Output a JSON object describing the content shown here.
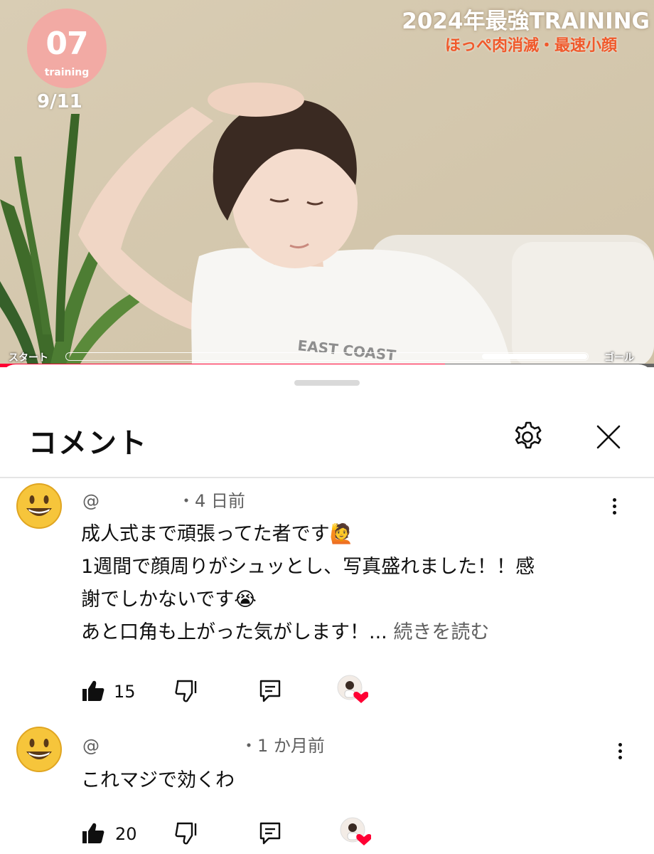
{
  "video": {
    "badge_number": "07",
    "badge_label": "training",
    "progress_count": "9/11",
    "title_line1": "2024年最強TRAINING",
    "title_line2": "ほっぺ肉消滅・最速小顔",
    "start_label": "スタート",
    "goal_label": "ゴール",
    "playback_progress_fraction": 0.68,
    "shirt_text": "EAST COAST",
    "accent_color": "#ff0033",
    "badge_color": "#f2aaa4"
  },
  "sheet": {
    "title": "コメント",
    "settings_icon": "gear-icon",
    "close_icon": "close-icon"
  },
  "comments": [
    {
      "handle": "@",
      "time": "・4 日前",
      "lines": [
        "成人式まで頑張ってた者です🙋",
        "1週間で顔周りがシュッとし、写真盛れました！！感",
        "謝でしかないです😭",
        "あと口角も上がった気がします！... "
      ],
      "read_more": "続きを読む",
      "likes": "15",
      "creator_hearted": true
    },
    {
      "handle": "@",
      "time": "・1 か月前",
      "lines": [
        "これマジで効くわ"
      ],
      "likes": "20",
      "creator_hearted": true
    }
  ]
}
